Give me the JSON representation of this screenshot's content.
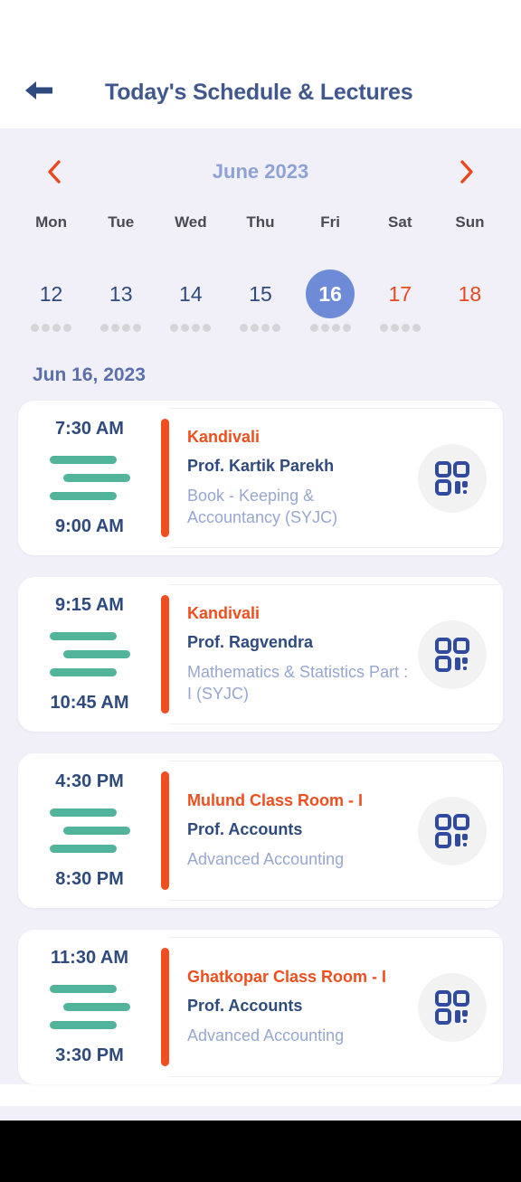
{
  "appbar": {
    "back_icon": "arrow-left-icon",
    "title": "Today's Schedule & Lectures"
  },
  "calendar": {
    "prev_icon": "chevron-left-icon",
    "next_icon": "chevron-right-icon",
    "month_label": "June 2023",
    "daynames": [
      "Mon",
      "Tue",
      "Wed",
      "Thu",
      "Fri",
      "Sat",
      "Sun"
    ],
    "days": [
      {
        "num": "12",
        "weekend": false,
        "selected": false,
        "dots": 4
      },
      {
        "num": "13",
        "weekend": false,
        "selected": false,
        "dots": 4
      },
      {
        "num": "14",
        "weekend": false,
        "selected": false,
        "dots": 4
      },
      {
        "num": "15",
        "weekend": false,
        "selected": false,
        "dots": 4
      },
      {
        "num": "16",
        "weekend": false,
        "selected": true,
        "dots": 4
      },
      {
        "num": "17",
        "weekend": true,
        "selected": false,
        "dots": 4
      },
      {
        "num": "18",
        "weekend": true,
        "selected": false,
        "dots": 0
      }
    ],
    "selected_date_label": "Jun 16, 2023",
    "colors": {
      "selected_bg": "#6e8bd8",
      "weekend_text": "#e8491c",
      "weekday_text": "#2f4a7d",
      "month_text": "#8ea2d6",
      "panel_bg": "#f1f0f9"
    }
  },
  "schedule": {
    "qr_icon": "qr-scan-icon",
    "bars_icon": "duration-bars-icon",
    "items": [
      {
        "start_time": "7:30 AM",
        "end_time": "9:00 AM",
        "room": "Kandivali",
        "professor": "Prof. Kartik Parekh",
        "subject": "Book - Keeping & Accountancy (SYJC)"
      },
      {
        "start_time": "9:15 AM",
        "end_time": "10:45 AM",
        "room": "Kandivali",
        "professor": "Prof. Ragvendra",
        "subject": "Mathematics & Statistics Part  : I (SYJC)"
      },
      {
        "start_time": "4:30 PM",
        "end_time": "8:30 PM",
        "room": "Mulund Class Room - I",
        "professor": "Prof. Accounts",
        "subject": "Advanced Accounting"
      },
      {
        "start_time": "11:30 AM",
        "end_time": "3:30 PM",
        "room": "Ghatkopar Class Room - I",
        "professor": "Prof. Accounts",
        "subject": "Advanced Accounting"
      }
    ],
    "colors": {
      "accent": "#ef4f1f",
      "bars": "#52b49a",
      "room_text": "#ef4f1f",
      "prof_text": "#2f4a7d",
      "subject_text": "#97a7d0"
    }
  }
}
